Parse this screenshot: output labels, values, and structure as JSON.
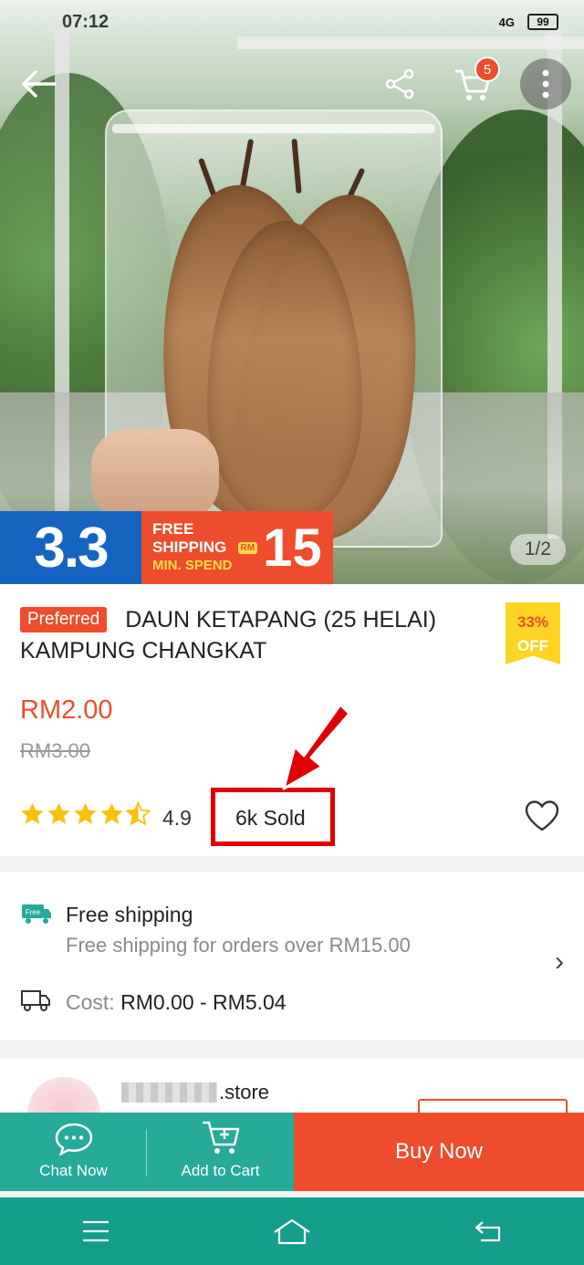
{
  "status_bar": {
    "time": "07:12",
    "network": "4G",
    "battery": "99"
  },
  "top_nav": {
    "cart_count": "5"
  },
  "banner": {
    "campaign": "3.3",
    "line1": "FREE",
    "line2": "SHIPPING",
    "line3": "MIN. SPEND",
    "currency": "RM",
    "amount": "15"
  },
  "image_pager": "1/2",
  "product": {
    "badge": "Preferred",
    "title": "DAUN KETAPANG (25 HELAI) KAMPUNG CHANGKAT",
    "discount_pct": "33%",
    "discount_off": "OFF",
    "price": "RM2.00",
    "original_price": "RM3.00",
    "rating": "4.9",
    "rating_stars": 4.5,
    "sold": "6k Sold"
  },
  "shipping": {
    "icon_label": "Free",
    "title": "Free shipping",
    "subtitle": "Free shipping for orders over RM15.00",
    "cost_label": "Cost:",
    "cost_value": "RM0.00 - RM5.04"
  },
  "shop": {
    "name_suffix": ".store"
  },
  "actions": {
    "chat": "Chat Now",
    "add_to_cart": "Add to Cart",
    "buy_now": "Buy Now"
  },
  "colors": {
    "brand": "#ee4d2d",
    "teal": "#26aa99",
    "star": "#ffc107",
    "highlight": "#e00000"
  }
}
